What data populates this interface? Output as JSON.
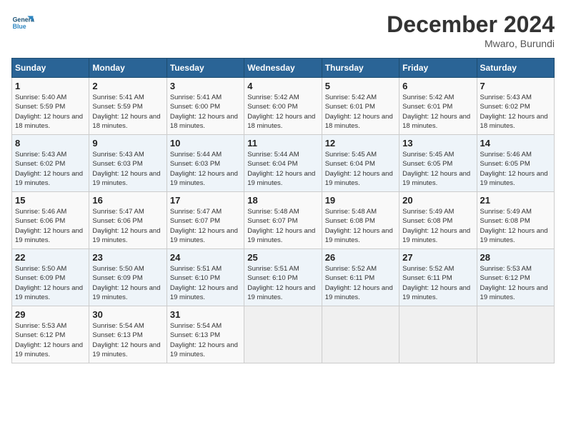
{
  "logo": {
    "line1": "General",
    "line2": "Blue"
  },
  "title": "December 2024",
  "location": "Mwaro, Burundi",
  "days_header": [
    "Sunday",
    "Monday",
    "Tuesday",
    "Wednesday",
    "Thursday",
    "Friday",
    "Saturday"
  ],
  "weeks": [
    [
      {
        "day": "1",
        "sunrise": "5:40 AM",
        "sunset": "5:59 PM",
        "daylight": "12 hours and 18 minutes."
      },
      {
        "day": "2",
        "sunrise": "5:41 AM",
        "sunset": "5:59 PM",
        "daylight": "12 hours and 18 minutes."
      },
      {
        "day": "3",
        "sunrise": "5:41 AM",
        "sunset": "6:00 PM",
        "daylight": "12 hours and 18 minutes."
      },
      {
        "day": "4",
        "sunrise": "5:42 AM",
        "sunset": "6:00 PM",
        "daylight": "12 hours and 18 minutes."
      },
      {
        "day": "5",
        "sunrise": "5:42 AM",
        "sunset": "6:01 PM",
        "daylight": "12 hours and 18 minutes."
      },
      {
        "day": "6",
        "sunrise": "5:42 AM",
        "sunset": "6:01 PM",
        "daylight": "12 hours and 18 minutes."
      },
      {
        "day": "7",
        "sunrise": "5:43 AM",
        "sunset": "6:02 PM",
        "daylight": "12 hours and 18 minutes."
      }
    ],
    [
      {
        "day": "8",
        "sunrise": "5:43 AM",
        "sunset": "6:02 PM",
        "daylight": "12 hours and 19 minutes."
      },
      {
        "day": "9",
        "sunrise": "5:43 AM",
        "sunset": "6:03 PM",
        "daylight": "12 hours and 19 minutes."
      },
      {
        "day": "10",
        "sunrise": "5:44 AM",
        "sunset": "6:03 PM",
        "daylight": "12 hours and 19 minutes."
      },
      {
        "day": "11",
        "sunrise": "5:44 AM",
        "sunset": "6:04 PM",
        "daylight": "12 hours and 19 minutes."
      },
      {
        "day": "12",
        "sunrise": "5:45 AM",
        "sunset": "6:04 PM",
        "daylight": "12 hours and 19 minutes."
      },
      {
        "day": "13",
        "sunrise": "5:45 AM",
        "sunset": "6:05 PM",
        "daylight": "12 hours and 19 minutes."
      },
      {
        "day": "14",
        "sunrise": "5:46 AM",
        "sunset": "6:05 PM",
        "daylight": "12 hours and 19 minutes."
      }
    ],
    [
      {
        "day": "15",
        "sunrise": "5:46 AM",
        "sunset": "6:06 PM",
        "daylight": "12 hours and 19 minutes."
      },
      {
        "day": "16",
        "sunrise": "5:47 AM",
        "sunset": "6:06 PM",
        "daylight": "12 hours and 19 minutes."
      },
      {
        "day": "17",
        "sunrise": "5:47 AM",
        "sunset": "6:07 PM",
        "daylight": "12 hours and 19 minutes."
      },
      {
        "day": "18",
        "sunrise": "5:48 AM",
        "sunset": "6:07 PM",
        "daylight": "12 hours and 19 minutes."
      },
      {
        "day": "19",
        "sunrise": "5:48 AM",
        "sunset": "6:08 PM",
        "daylight": "12 hours and 19 minutes."
      },
      {
        "day": "20",
        "sunrise": "5:49 AM",
        "sunset": "6:08 PM",
        "daylight": "12 hours and 19 minutes."
      },
      {
        "day": "21",
        "sunrise": "5:49 AM",
        "sunset": "6:08 PM",
        "daylight": "12 hours and 19 minutes."
      }
    ],
    [
      {
        "day": "22",
        "sunrise": "5:50 AM",
        "sunset": "6:09 PM",
        "daylight": "12 hours and 19 minutes."
      },
      {
        "day": "23",
        "sunrise": "5:50 AM",
        "sunset": "6:09 PM",
        "daylight": "12 hours and 19 minutes."
      },
      {
        "day": "24",
        "sunrise": "5:51 AM",
        "sunset": "6:10 PM",
        "daylight": "12 hours and 19 minutes."
      },
      {
        "day": "25",
        "sunrise": "5:51 AM",
        "sunset": "6:10 PM",
        "daylight": "12 hours and 19 minutes."
      },
      {
        "day": "26",
        "sunrise": "5:52 AM",
        "sunset": "6:11 PM",
        "daylight": "12 hours and 19 minutes."
      },
      {
        "day": "27",
        "sunrise": "5:52 AM",
        "sunset": "6:11 PM",
        "daylight": "12 hours and 19 minutes."
      },
      {
        "day": "28",
        "sunrise": "5:53 AM",
        "sunset": "6:12 PM",
        "daylight": "12 hours and 19 minutes."
      }
    ],
    [
      {
        "day": "29",
        "sunrise": "5:53 AM",
        "sunset": "6:12 PM",
        "daylight": "12 hours and 19 minutes."
      },
      {
        "day": "30",
        "sunrise": "5:54 AM",
        "sunset": "6:13 PM",
        "daylight": "12 hours and 19 minutes."
      },
      {
        "day": "31",
        "sunrise": "5:54 AM",
        "sunset": "6:13 PM",
        "daylight": "12 hours and 19 minutes."
      },
      null,
      null,
      null,
      null
    ]
  ]
}
